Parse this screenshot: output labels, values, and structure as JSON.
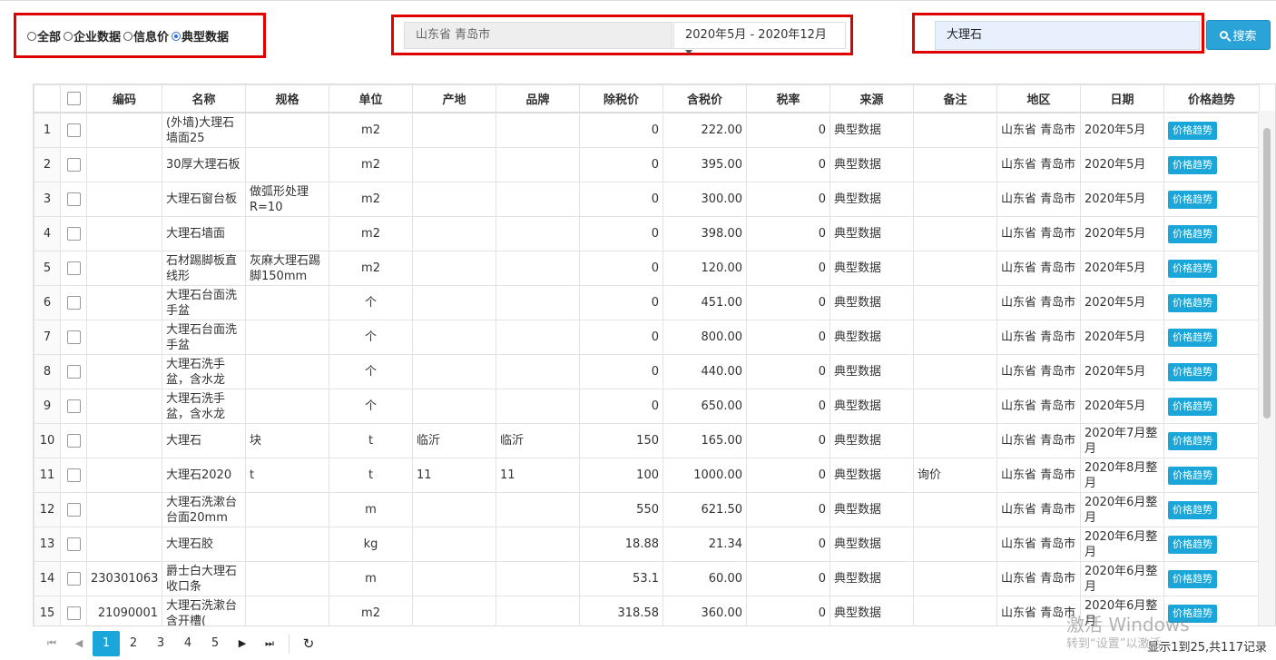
{
  "filters": {
    "options": [
      {
        "label": "全部",
        "checked": false
      },
      {
        "label": "企业数据",
        "checked": false
      },
      {
        "label": "信息价",
        "checked": false
      },
      {
        "label": "典型数据",
        "checked": true
      }
    ],
    "region": "山东省 青岛市",
    "date_range": "2020年5月 - 2020年12月",
    "search_value": "大理石",
    "search_button": "搜索"
  },
  "table": {
    "headers": [
      "编码",
      "名称",
      "规格",
      "单位",
      "产地",
      "品牌",
      "除税价",
      "含税价",
      "税率",
      "来源",
      "备注",
      "地区",
      "日期",
      "价格趋势"
    ],
    "rows": [
      {
        "idx": "1",
        "code": "",
        "name": "(外墙)大理石墙面25",
        "spec": "",
        "unit": "m2",
        "origin": "",
        "brand": "",
        "pretax": "0",
        "taxed": "222.00",
        "rate": "0",
        "source": "典型数据",
        "remark": "",
        "region": "山东省 青岛市",
        "date": "2020年5月",
        "trend": "价格趋势"
      },
      {
        "idx": "2",
        "code": "",
        "name": "30厚大理石板",
        "spec": "",
        "unit": "m2",
        "origin": "",
        "brand": "",
        "pretax": "0",
        "taxed": "395.00",
        "rate": "0",
        "source": "典型数据",
        "remark": "",
        "region": "山东省 青岛市",
        "date": "2020年5月",
        "trend": "价格趋势"
      },
      {
        "idx": "3",
        "code": "",
        "name": "大理石窗台板",
        "spec": "做弧形处理R=10",
        "unit": "m2",
        "origin": "",
        "brand": "",
        "pretax": "0",
        "taxed": "300.00",
        "rate": "0",
        "source": "典型数据",
        "remark": "",
        "region": "山东省 青岛市",
        "date": "2020年5月",
        "trend": "价格趋势"
      },
      {
        "idx": "4",
        "code": "",
        "name": "大理石墙面",
        "spec": "",
        "unit": "m2",
        "origin": "",
        "brand": "",
        "pretax": "0",
        "taxed": "398.00",
        "rate": "0",
        "source": "典型数据",
        "remark": "",
        "region": "山东省 青岛市",
        "date": "2020年5月",
        "trend": "价格趋势"
      },
      {
        "idx": "5",
        "code": "",
        "name": "石材踢脚板直线形",
        "spec": "灰麻大理石踢脚150mm",
        "unit": "m2",
        "origin": "",
        "brand": "",
        "pretax": "0",
        "taxed": "120.00",
        "rate": "0",
        "source": "典型数据",
        "remark": "",
        "region": "山东省 青岛市",
        "date": "2020年5月",
        "trend": "价格趋势"
      },
      {
        "idx": "6",
        "code": "",
        "name": "大理石台面洗手盆",
        "spec": "",
        "unit": "个",
        "origin": "",
        "brand": "",
        "pretax": "0",
        "taxed": "451.00",
        "rate": "0",
        "source": "典型数据",
        "remark": "",
        "region": "山东省 青岛市",
        "date": "2020年5月",
        "trend": "价格趋势"
      },
      {
        "idx": "7",
        "code": "",
        "name": "大理石台面洗手盆",
        "spec": "",
        "unit": "个",
        "origin": "",
        "brand": "",
        "pretax": "0",
        "taxed": "800.00",
        "rate": "0",
        "source": "典型数据",
        "remark": "",
        "region": "山东省 青岛市",
        "date": "2020年5月",
        "trend": "价格趋势"
      },
      {
        "idx": "8",
        "code": "",
        "name": "大理石洗手盆，含水龙",
        "spec": "",
        "unit": "个",
        "origin": "",
        "brand": "",
        "pretax": "0",
        "taxed": "440.00",
        "rate": "0",
        "source": "典型数据",
        "remark": "",
        "region": "山东省 青岛市",
        "date": "2020年5月",
        "trend": "价格趋势"
      },
      {
        "idx": "9",
        "code": "",
        "name": "大理石洗手盆，含水龙",
        "spec": "",
        "unit": "个",
        "origin": "",
        "brand": "",
        "pretax": "0",
        "taxed": "650.00",
        "rate": "0",
        "source": "典型数据",
        "remark": "",
        "region": "山东省 青岛市",
        "date": "2020年5月",
        "trend": "价格趋势"
      },
      {
        "idx": "10",
        "code": "",
        "name": "大理石",
        "spec": "块",
        "unit": "t",
        "origin": "临沂",
        "brand": "临沂",
        "pretax": "150",
        "taxed": "165.00",
        "rate": "0",
        "source": "典型数据",
        "remark": "",
        "region": "山东省 青岛市",
        "date": "2020年7月整月",
        "trend": "价格趋势"
      },
      {
        "idx": "11",
        "code": "",
        "name": "大理石2020",
        "spec": "t",
        "unit": "t",
        "origin": "11",
        "brand": "11",
        "pretax": "100",
        "taxed": "1000.00",
        "rate": "0",
        "source": "典型数据",
        "remark": "询价",
        "region": "山东省 青岛市",
        "date": "2020年8月整月",
        "trend": "价格趋势"
      },
      {
        "idx": "12",
        "code": "",
        "name": "大理石洗漱台台面20mm",
        "spec": "",
        "unit": "m",
        "origin": "",
        "brand": "",
        "pretax": "550",
        "taxed": "621.50",
        "rate": "0",
        "source": "典型数据",
        "remark": "",
        "region": "山东省 青岛市",
        "date": "2020年6月整月",
        "trend": "价格趋势"
      },
      {
        "idx": "13",
        "code": "",
        "name": "大理石胶",
        "spec": "",
        "unit": "kg",
        "origin": "",
        "brand": "",
        "pretax": "18.88",
        "taxed": "21.34",
        "rate": "0",
        "source": "典型数据",
        "remark": "",
        "region": "山东省 青岛市",
        "date": "2020年6月整月",
        "trend": "价格趋势"
      },
      {
        "idx": "14",
        "code": "230301063",
        "name": "爵士白大理石收口条",
        "spec": "",
        "unit": "m",
        "origin": "",
        "brand": "",
        "pretax": "53.1",
        "taxed": "60.00",
        "rate": "0",
        "source": "典型数据",
        "remark": "",
        "region": "山东省 青岛市",
        "date": "2020年6月整月",
        "trend": "价格趋势"
      },
      {
        "idx": "15",
        "code": "21090001",
        "name": "大理石洗漱台含开槽(",
        "spec": "",
        "unit": "m2",
        "origin": "",
        "brand": "",
        "pretax": "318.58",
        "taxed": "360.00",
        "rate": "0",
        "source": "典型数据",
        "remark": "",
        "region": "山东省 青岛市",
        "date": "2020年6月整月",
        "trend": "价格趋势"
      }
    ]
  },
  "pager": {
    "pages": [
      "1",
      "2",
      "3",
      "4",
      "5"
    ],
    "active": "1",
    "info": "显示1到25,共117记录"
  },
  "watermark": {
    "line1": "激活 Windows",
    "line2": "转到“设置”以激活"
  }
}
